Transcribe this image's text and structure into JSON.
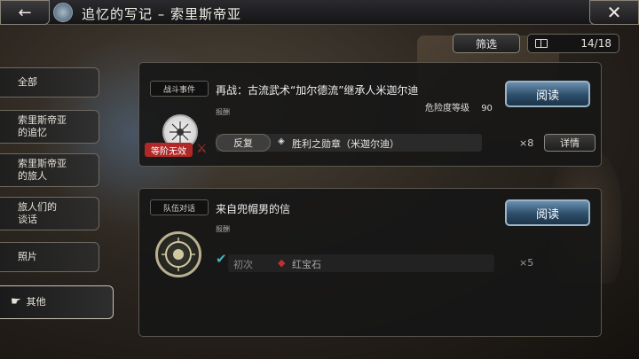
{
  "header": {
    "title": "追忆的写记 – 索里斯帝亚",
    "back_icon": "back-arrow-icon",
    "close_icon": "close-icon"
  },
  "toolbar": {
    "filter_label": "筛选",
    "counter": "14/18"
  },
  "sidebar": {
    "items": [
      {
        "label": "全部"
      },
      {
        "label": "索里斯帝亚\n的追忆"
      },
      {
        "label": "索里斯帝亚\n的旅人"
      },
      {
        "label": "旅人们的\n谈话"
      },
      {
        "label": "照片"
      },
      {
        "label": "其他"
      }
    ]
  },
  "entries": [
    {
      "tag": "战斗事件",
      "title": "再战：古流武术“加尔德流”继承人米迦尔迪",
      "danger_label": "危险度等级",
      "danger_value": "90",
      "reward_label": "报酬",
      "rank_badge": "等阶无效",
      "repeat_label": "反复",
      "reward_item": "胜利之勋章（米迦尔迪）",
      "reward_count": "×8",
      "detail_label": "详情",
      "read_label": "阅读"
    },
    {
      "tag": "队伍对话",
      "title": "来自兜帽男的信",
      "reward_label": "报酬",
      "first_label": "初次",
      "reward_item": "红宝石",
      "reward_count": "×5",
      "read_label": "阅读"
    }
  ],
  "colors": {
    "accent_blue": "#2d4e6a",
    "rank_red": "#b02828",
    "check_teal": "#4ab0c0",
    "gem_red": "#c03030"
  }
}
